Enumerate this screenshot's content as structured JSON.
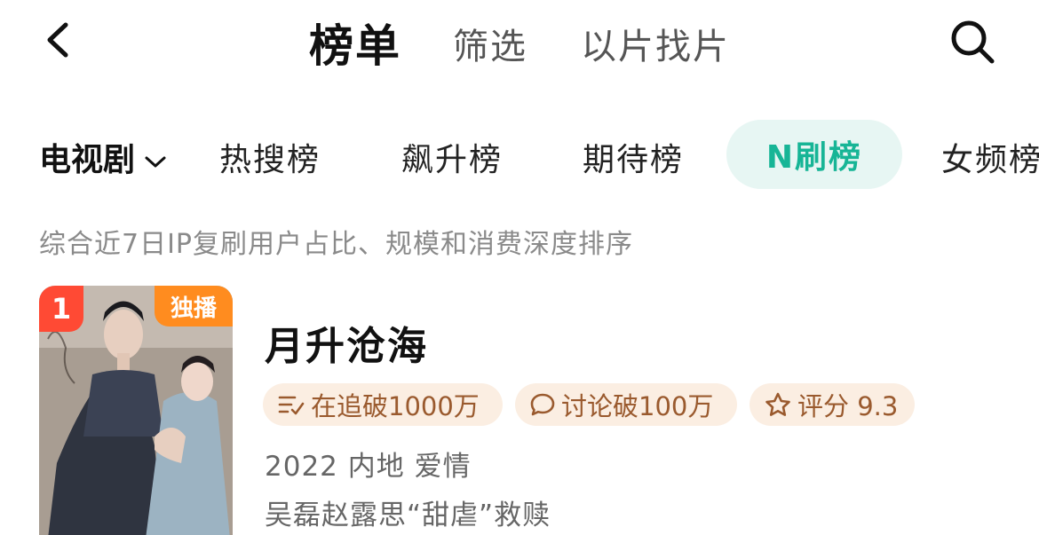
{
  "header": {
    "title": "榜单",
    "tabs": [
      {
        "label": "筛选"
      },
      {
        "label": "以片找片"
      }
    ]
  },
  "categories": {
    "dropdown_label": "电视剧",
    "tabs": [
      {
        "label": "热搜榜"
      },
      {
        "label": "飙升榜"
      },
      {
        "label": "期待榜"
      },
      {
        "label": "N刷榜",
        "active": true
      },
      {
        "label": "女频榜"
      }
    ],
    "active_color": "#17b596"
  },
  "subtitle": "综合近7日IP复刷用户占比、规模和消费深度排序",
  "items": [
    {
      "rank": "1",
      "badge": "独播",
      "title": "月升沧海",
      "tags": [
        {
          "icon": "list-check-icon",
          "label": "在追破1000万"
        },
        {
          "icon": "chat-bubble-icon",
          "label": "讨论破100万"
        },
        {
          "icon": "star-icon",
          "label": "评分 9.3"
        }
      ],
      "meta": "2022 内地 爱情",
      "description": "吴磊赵露思“甜虐”救赎"
    }
  ]
}
